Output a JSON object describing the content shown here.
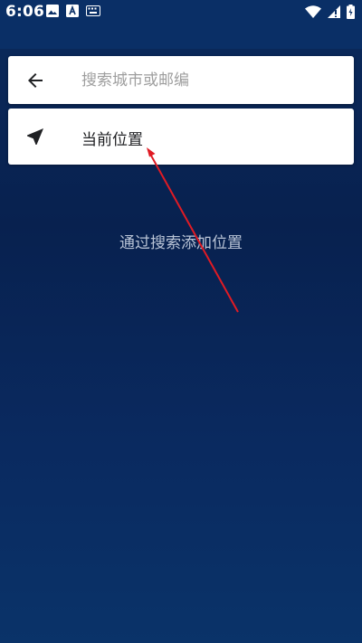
{
  "status_bar": {
    "time": "6:06",
    "left_icons": [
      "image-icon",
      "a-badge-icon",
      "keyboard-icon"
    ],
    "right_icons": [
      "wifi-icon",
      "signal-icon",
      "battery-icon"
    ]
  },
  "search": {
    "back_icon": "arrow-left-icon",
    "placeholder": "搜索城市或邮编",
    "value": ""
  },
  "current_location": {
    "icon": "navigation-arrow-icon",
    "label": "当前位置"
  },
  "hint": "通过搜索添加位置",
  "colors": {
    "background_top": "#0b2a5c",
    "background_bottom": "#0a3369",
    "card": "#ffffff",
    "annotation": "#e01b24"
  }
}
